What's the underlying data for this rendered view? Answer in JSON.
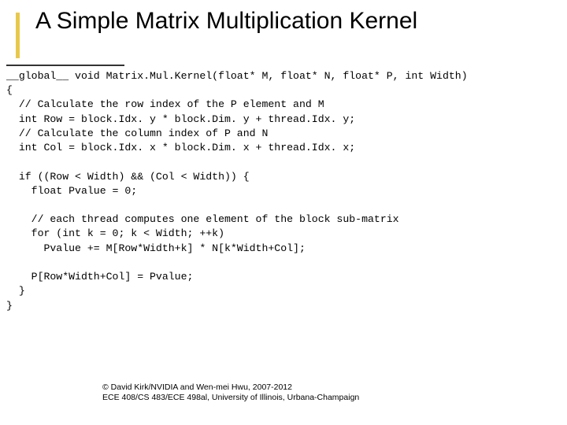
{
  "title": "A Simple Matrix Multiplication Kernel",
  "code": "__global__ void Matrix.Mul.Kernel(float* M, float* N, float* P, int Width)\n{\n  // Calculate the row index of the P element and M\n  int Row = block.Idx. y * block.Dim. y + thread.Idx. y;\n  // Calculate the column index of P and N\n  int Col = block.Idx. x * block.Dim. x + thread.Idx. x;\n\n  if ((Row < Width) && (Col < Width)) {\n    float Pvalue = 0;\n\n    // each thread computes one element of the block sub-matrix\n    for (int k = 0; k < Width; ++k)\n      Pvalue += M[Row*Width+k] * N[k*Width+Col];\n\n    P[Row*Width+Col] = Pvalue;\n  }\n}",
  "footer_line1": "© David Kirk/NVIDIA and Wen-mei Hwu, 2007-2012",
  "footer_line2": "ECE 408/CS 483/ECE 498al, University of Illinois, Urbana-Champaign"
}
